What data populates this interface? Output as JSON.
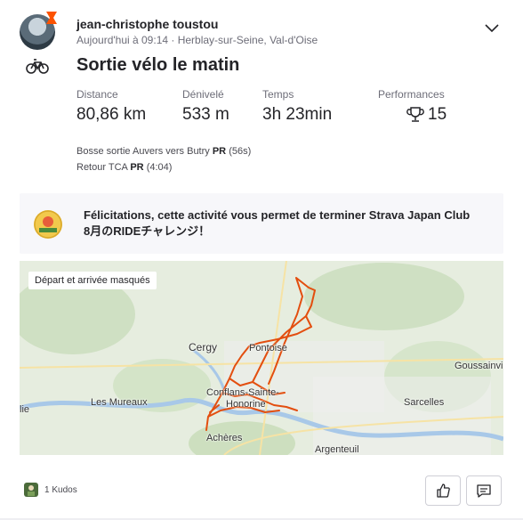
{
  "activity": {
    "athlete": "jean-christophe toustou",
    "meta": "Aujourd'hui à 09:14 · Herblay-sur-Seine, Val-d'Oise",
    "title": "Sortie vélo le matin",
    "sport_icon": "bike-icon"
  },
  "stats": [
    {
      "label": "Distance",
      "value": "80,86 km"
    },
    {
      "label": "Dénivelé",
      "value": "533 m"
    },
    {
      "label": "Temps",
      "value": "3h 23min"
    },
    {
      "label": "Performances",
      "value": "15",
      "icon": "trophy-icon"
    }
  ],
  "segments": [
    {
      "name": "Bosse sortie Auvers vers Butry",
      "badge": "PR",
      "time": "(56s)"
    },
    {
      "name": "Retour TCA",
      "badge": "PR",
      "time": "(4:04)"
    }
  ],
  "banner": {
    "text_line1": "Félicitations, cette activité vous permet de terminer Strava Japan Club",
    "text_line2": "8月のRIDEチャレンジ！"
  },
  "map": {
    "hint": "Départ et arrivée masqués",
    "places": {
      "cergy": "Cergy",
      "pontoise": "Pontoise",
      "goussainville": "Goussainvi",
      "les_mureaux": "Les Mureaux",
      "conflans": "Conflans-Sainte-",
      "honorine": "Honorine",
      "sarcelles": "Sarcelles",
      "ecquevilly": "lie",
      "acheres": "Achères",
      "argenteuil": "Argenteuil"
    },
    "route_color": "#e34e0f"
  },
  "footer": {
    "kudos": "1 Kudos",
    "kudo_icon": "thumbs-up-icon",
    "comment_icon": "comment-icon"
  },
  "colors": {
    "accent": "#fc5200",
    "text": "#242428",
    "muted": "#6d6d78"
  }
}
